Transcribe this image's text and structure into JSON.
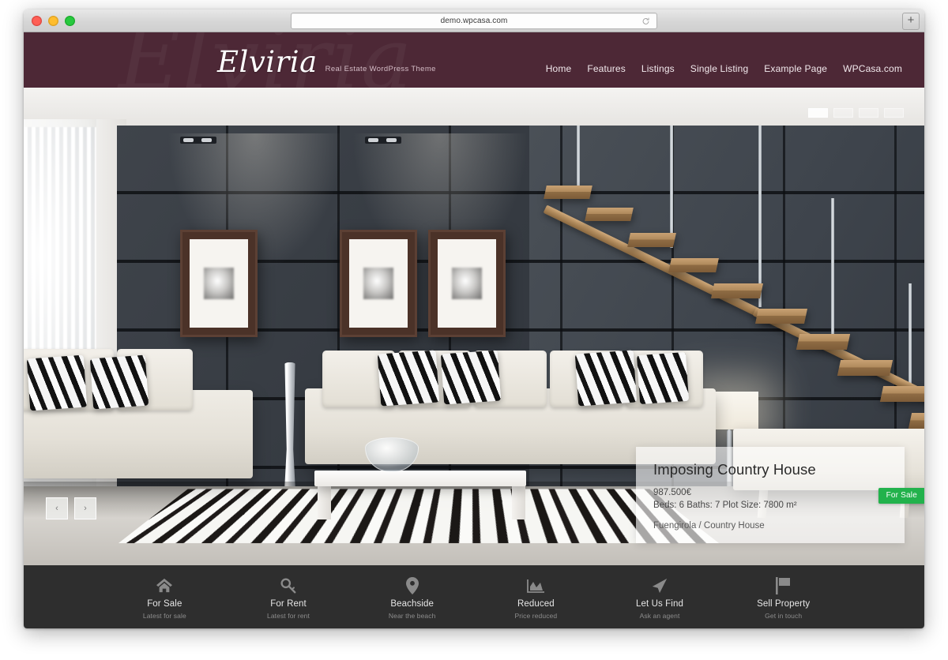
{
  "browser": {
    "url": "demo.wpcasa.com",
    "reload_icon": "reload-icon",
    "newtab_label": "+",
    "traffic_lights": [
      "close",
      "minimize",
      "zoom"
    ]
  },
  "site": {
    "logo": "Elviria",
    "tagline": "Real Estate WordPress Theme",
    "header_color": "#4d2836",
    "nav": [
      {
        "label": "Home"
      },
      {
        "label": "Features"
      },
      {
        "label": "Listings"
      },
      {
        "label": "Single Listing"
      },
      {
        "label": "Example Page"
      },
      {
        "label": "WPCasa.com"
      }
    ]
  },
  "hero": {
    "pager": [
      {
        "active": true
      },
      {
        "active": false
      },
      {
        "active": false
      },
      {
        "active": false
      }
    ],
    "prev_label": "‹",
    "next_label": "›",
    "property": {
      "title": "Imposing Country House",
      "price": "987.500€",
      "specs": "Beds: 6 Baths: 7 Plot Size: 7800 m²",
      "location": "Fuengirola / Country House",
      "badge": "For Sale",
      "badge_color": "#22b24c"
    }
  },
  "action_bar": {
    "background": "#2e2e2e",
    "items": [
      {
        "icon": "home-icon",
        "label": "For Sale",
        "sub": "Latest for sale"
      },
      {
        "icon": "key-icon",
        "label": "For Rent",
        "sub": "Latest for rent"
      },
      {
        "icon": "map-pin-icon",
        "label": "Beachside",
        "sub": "Near the beach"
      },
      {
        "icon": "chart-icon",
        "label": "Reduced",
        "sub": "Price reduced"
      },
      {
        "icon": "paper-plane-icon",
        "label": "Let Us Find",
        "sub": "Ask an agent"
      },
      {
        "icon": "flag-icon",
        "label": "Sell Property",
        "sub": "Get in touch"
      }
    ]
  }
}
